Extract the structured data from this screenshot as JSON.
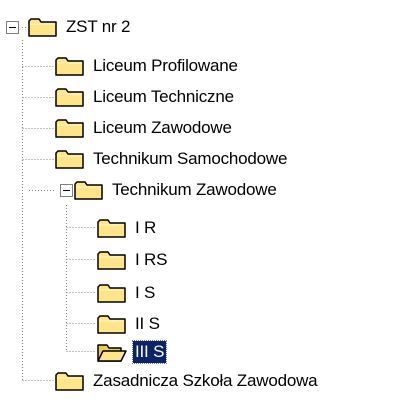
{
  "tree": {
    "root": {
      "label": "ZST nr 2",
      "expanded": true
    },
    "children": [
      {
        "label": "Liceum Profilowane"
      },
      {
        "label": "Liceum Techniczne"
      },
      {
        "label": "Liceum Zawodowe"
      },
      {
        "label": "Technikum Samochodowe"
      },
      {
        "label": "Technikum Zawodowe",
        "expanded": true,
        "children": [
          {
            "label": "I R"
          },
          {
            "label": "I RS"
          },
          {
            "label": "I S"
          },
          {
            "label": "II S"
          },
          {
            "label": "III S",
            "selected": true,
            "open": true
          }
        ]
      },
      {
        "label": "Zasadnicza Szkoła Zawodowa"
      }
    ]
  },
  "colors": {
    "selection_bg": "#0a246a",
    "selection_text": "#ffffff",
    "folder_fill": "#ffe58a",
    "folder_outline": "#000000",
    "tree_lines": "#808080"
  },
  "icons": {
    "folder": "folder-icon",
    "open_folder": "open-folder-icon",
    "collapse": "collapse-minus-icon"
  }
}
